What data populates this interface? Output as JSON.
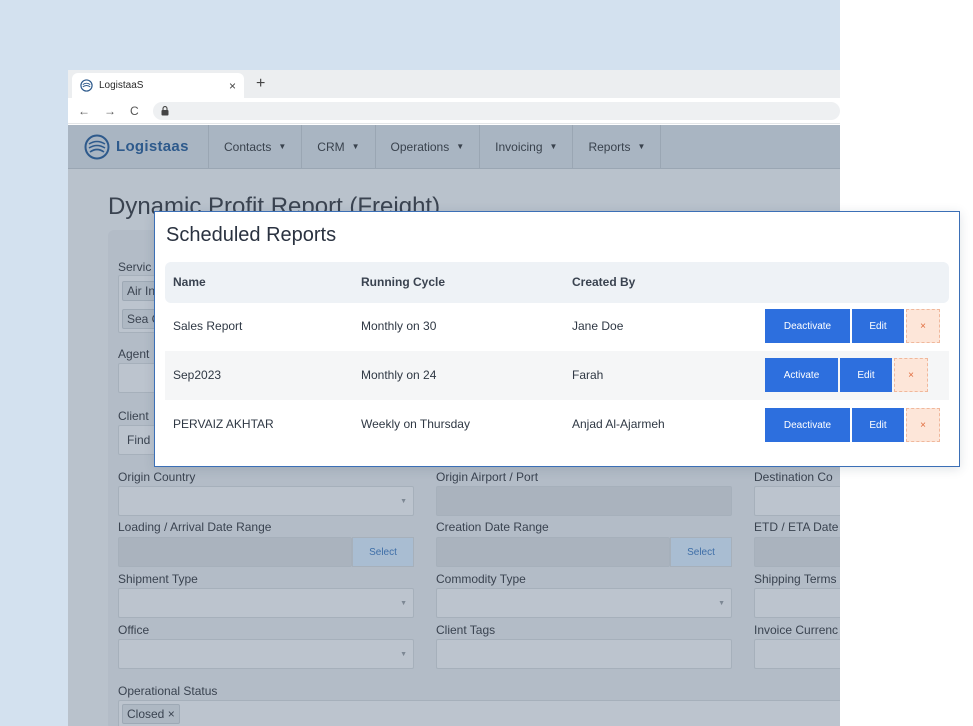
{
  "browser": {
    "tab_title": "LogistaaS",
    "tab_close": "×",
    "new_tab": "+",
    "nav_back": "←",
    "nav_forward": "→",
    "nav_reload": "C",
    "lock_glyph": "🔒"
  },
  "app": {
    "logo_text": "Logistaas",
    "nav": [
      {
        "label": "Contacts"
      },
      {
        "label": "CRM"
      },
      {
        "label": "Operations"
      },
      {
        "label": "Invoicing"
      },
      {
        "label": "Reports"
      }
    ],
    "page_title": "Dynamic Profit Report (Freight)",
    "form": {
      "service_label": "Servic",
      "service_chip_1": "Air In",
      "service_chip_2": "Sea C",
      "agent_label": "Agent",
      "client_label": "Client",
      "client_placeholder": "Find",
      "origin_country_label": "Origin Country",
      "origin_airport_label": "Origin Airport / Port",
      "destination_country_label": "Destination Co",
      "loading_date_label": "Loading / Arrival Date Range",
      "creation_date_label": "Creation Date Range",
      "etd_eta_label": "ETD / ETA Date",
      "select_label": "Select",
      "shipment_type_label": "Shipment Type",
      "commodity_type_label": "Commodity Type",
      "shipping_terms_label": "Shipping Terms",
      "office_label": "Office",
      "client_tags_label": "Client Tags",
      "invoice_currency_label": "Invoice Currenc",
      "operational_status_label": "Operational Status",
      "operational_status_chip": "Closed ×"
    }
  },
  "modal": {
    "title": "Scheduled Reports",
    "columns": [
      "Name",
      "Running Cycle",
      "Created By"
    ],
    "rows": [
      {
        "name": "Sales Report",
        "cycle": "Monthly on 30",
        "created_by": "Jane Doe",
        "toggle_label": "Deactivate",
        "edit_label": "Edit",
        "delete_label": "×"
      },
      {
        "name": "Sep2023",
        "cycle": "Monthly on 24",
        "created_by": "Farah",
        "toggle_label": "Activate",
        "edit_label": "Edit",
        "delete_label": "×"
      },
      {
        "name": "PERVAIZ AKHTAR",
        "cycle": "Weekly on Thursday",
        "created_by": "Anjad Al-Ajarmeh",
        "toggle_label": "Deactivate",
        "edit_label": "Edit",
        "delete_label": "×"
      }
    ]
  },
  "colors": {
    "background_panel": "#d3e1ef",
    "primary_button": "#2d6fde",
    "danger_button_bg": "#fde6d9",
    "danger_button_text": "#e06a3b",
    "modal_border": "#3b6fb6"
  }
}
